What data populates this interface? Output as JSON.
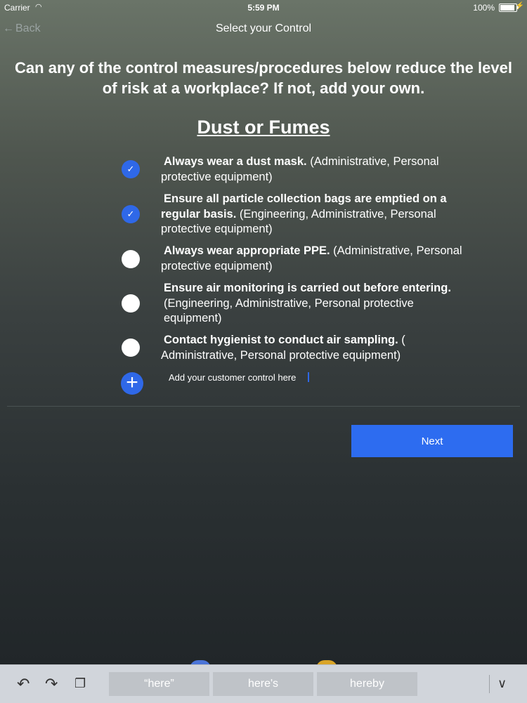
{
  "status_bar": {
    "carrier": "Carrier",
    "time": "5:59 PM",
    "battery": "100%",
    "battery_level": 1.0
  },
  "nav": {
    "back_label": "Back",
    "title": "Select your Control"
  },
  "question": "Can any of the control measures/procedures below reduce the level of risk at a workplace? If not, add your own.",
  "section_title": "Dust or Fumes",
  "controls": [
    {
      "bold": "Always wear a dust mask.",
      "detail": " (Administrative, Personal protective equipment)",
      "checked": true
    },
    {
      "bold": "Ensure all particle collection bags are emptied on a regular basis.",
      "detail": " (Engineering,  Administrative, Personal protective equipment)",
      "checked": true
    },
    {
      "bold": "Always wear appropriate PPE.",
      "detail": " (Administrative, Personal protective equipment)",
      "checked": false
    },
    {
      "bold": "Ensure air monitoring is carried out before entering.",
      "detail": " (Engineering,  Administrative,  Personal protective equipment)",
      "checked": false
    },
    {
      "bold": "Contact hygienist to conduct air sampling.",
      "detail": " ( Administrative,  Personal protective equipment)",
      "checked": false
    }
  ],
  "custom_control": {
    "value": "Add your customer control here"
  },
  "next_label": "Next",
  "keyboard": {
    "suggestions": [
      "“here”",
      "here's",
      "hereby"
    ]
  },
  "colors": {
    "accent": "#2d6cf0",
    "checkbox": "#2f68e8"
  }
}
